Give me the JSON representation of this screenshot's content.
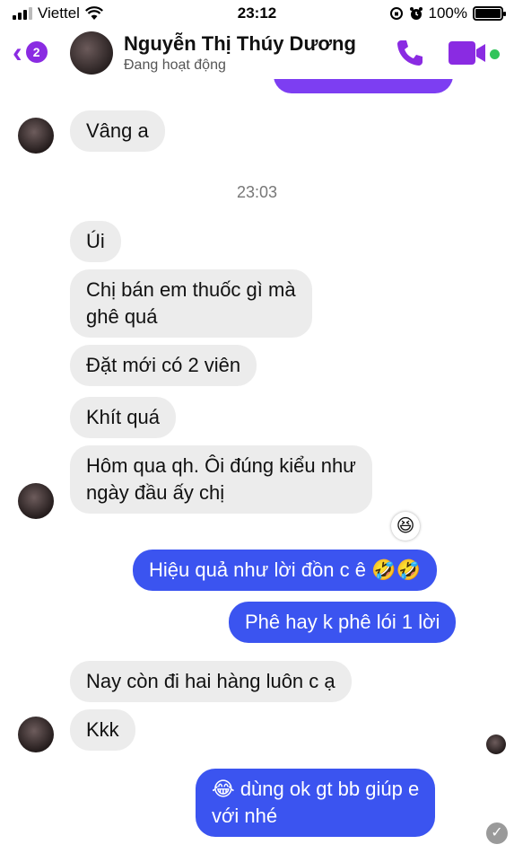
{
  "status_bar": {
    "carrier": "Viettel",
    "time": "23:12",
    "battery": "100%",
    "battery_level": 1.0
  },
  "header": {
    "contact_name": "Nguyễn Thị Thúy Dương",
    "contact_status": "Đang hoạt động",
    "unread_badge": "2",
    "accent_color": "#8a2be2"
  },
  "colors": {
    "incoming_bubble": "#ececec",
    "outgoing_bubble": "#3b54f0",
    "online_dot": "#31c45a"
  },
  "messages": {
    "m1": "Vâng a",
    "timestamp": "23:03",
    "m2": "Úi",
    "m3_line1": "Chị bán em thuốc gì mà",
    "m3_line2": "ghê quá",
    "m4": "Đặt mới có 2 viên",
    "m5": "Khít quá",
    "m6_line1": "Hôm qua qh. Ôi đúng kiểu như",
    "m6_line2": "ngày đầu ấy chị",
    "reaction": "😆",
    "o1": "Hiệu quả như lời đồn c ê 🤣🤣",
    "o2": "Phê hay k phê lói 1 lời",
    "m7": "Nay còn đi hai hàng luôn c ạ",
    "m8": "Kkk",
    "o3_line1": "😂 dùng ok gt bb giúp e",
    "o3_line2": "với nhé",
    "sent_mark": "✓"
  }
}
